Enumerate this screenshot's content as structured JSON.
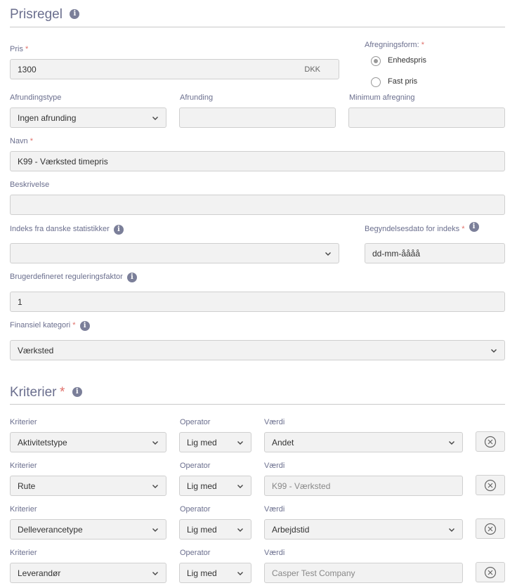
{
  "prisregel": {
    "title": "Prisregel",
    "pris_label": "Pris",
    "pris_value": "1300",
    "pris_unit": "DKK",
    "afregningsform_label": "Afregningsform:",
    "radio_enhedspris": "Enhedspris",
    "radio_fast_pris": "Fast pris",
    "afregningsform_selected": "Enhedspris",
    "afrundingstype_label": "Afrundingstype",
    "afrundingstype_value": "Ingen afrunding",
    "afrunding_label": "Afrunding",
    "afrunding_value": "",
    "minimum_label": "Minimum afregning",
    "minimum_value": "",
    "navn_label": "Navn",
    "navn_value": "K99 - Værksted timepris",
    "beskrivelse_label": "Beskrivelse",
    "beskrivelse_value": "",
    "indeks_label": "Indeks fra danske statistikker",
    "indeks_value": "",
    "begyndelsesdato_label": "Begyndelsesdato for indeks",
    "begyndelsesdato_placeholder": "dd-mm-åååå",
    "faktor_label": "Brugerdefineret reguleringsfaktor",
    "faktor_value": "1",
    "kategori_label": "Finansiel kategori",
    "kategori_value": "Værksted"
  },
  "kriterier": {
    "title": "Kriterier",
    "col_kriterier": "Kriterier",
    "col_operator": "Operator",
    "col_vaerdi": "Værdi",
    "rows": [
      {
        "kriterie": "Aktivitetstype",
        "operator": "Lig med",
        "vaerdi": "Andet"
      },
      {
        "kriterie": "Rute",
        "operator": "Lig med",
        "vaerdi": "K99 - Værksted"
      },
      {
        "kriterie": "Delleverancetype",
        "operator": "Lig med",
        "vaerdi": "Arbejdstid"
      },
      {
        "kriterie": "Leverandør",
        "operator": "Lig med",
        "vaerdi": "Casper Test Company"
      }
    ]
  },
  "required_marker": "*",
  "info_glyph": "i",
  "icons": {
    "info": "info-icon",
    "chevron": "chevron-down-icon",
    "remove": "remove-circle-x-icon"
  },
  "colors": {
    "heading": "#6b6f8e",
    "required": "#e0706a",
    "field_bg": "#f2f2f2"
  }
}
